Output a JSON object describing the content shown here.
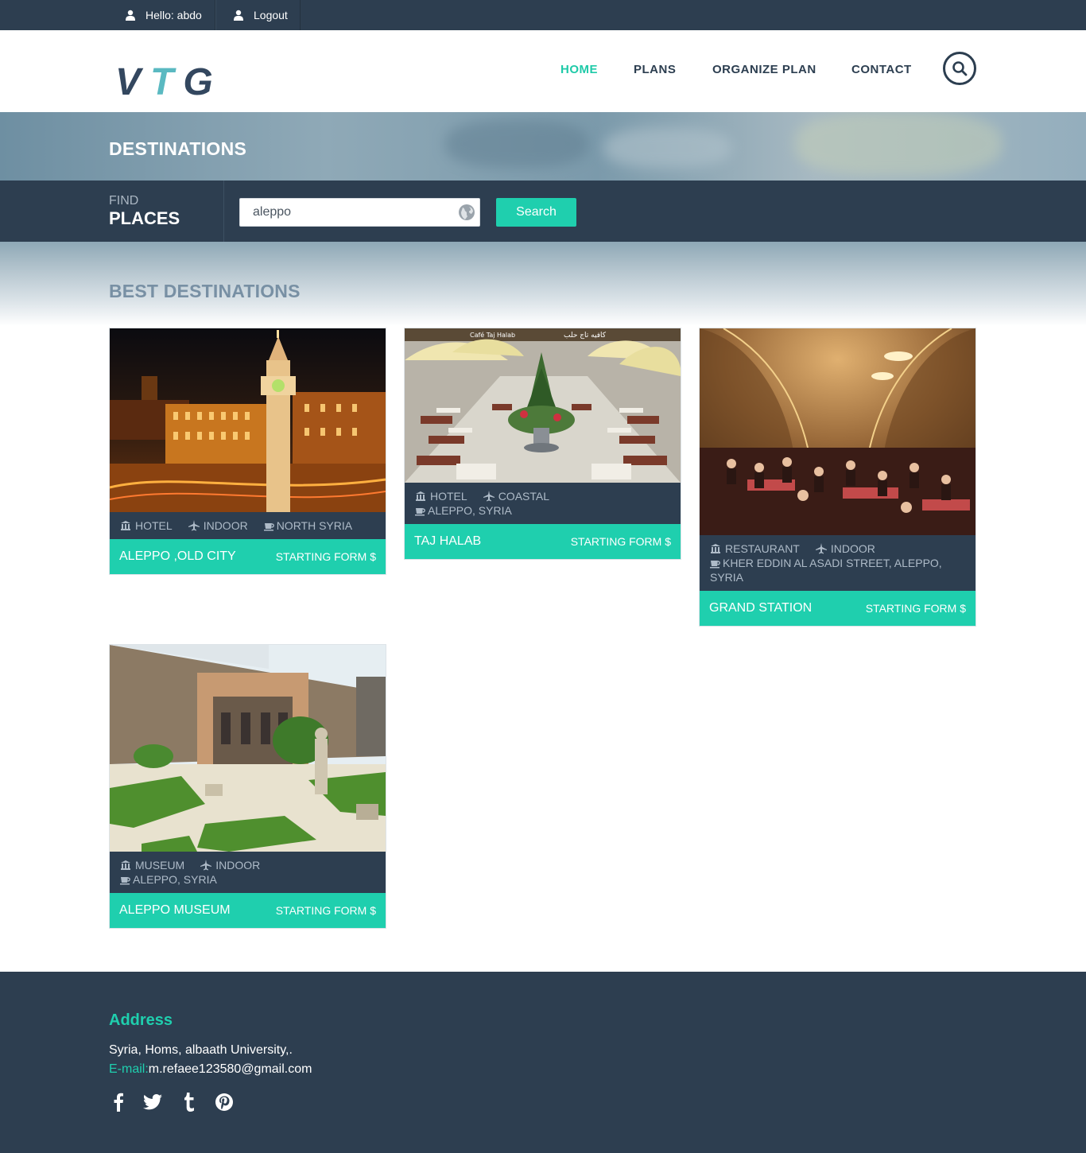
{
  "topbar": {
    "hello": "Hello: abdo",
    "logout": "Logout"
  },
  "brand": {
    "l1": "V",
    "l2": "T",
    "l3": "G"
  },
  "nav": {
    "home": "HOME",
    "plans": "PLANS",
    "organize": "ORGANIZE PLAN",
    "contact": "CONTACT"
  },
  "page": {
    "title": "DESTINATIONS"
  },
  "find": {
    "small": "FIND",
    "big": "PLACES",
    "query": "aleppo",
    "button": "Search"
  },
  "section": {
    "title": "BEST DESTINATIONS"
  },
  "cards": [
    {
      "type": "HOTEL",
      "category": "INDOOR",
      "location": "NORTH SYRIA",
      "name": "ALEPPO ,OLD CITY",
      "price": "STARTING FORM $",
      "image": "night city clock tower"
    },
    {
      "type": "HOTEL",
      "category": "COASTAL",
      "location": "ALEPPO, SYRIA",
      "name": "TAJ HALAB",
      "price": "STARTING FORM $",
      "image": "outdoor cafe courtyard",
      "sign_latin": "Café Taj Halab",
      "sign_arabic": "كافيه تاج حلب"
    },
    {
      "type": "RESTAURANT",
      "category": "INDOOR",
      "location": "KHER EDDIN AL ASADI STREET, ALEPPO, SYRIA",
      "name": "GRAND STATION",
      "price": "STARTING FORM $",
      "image": "vaulted restaurant hall"
    },
    {
      "type": "MUSEUM",
      "category": "INDOOR",
      "location": "ALEPPO, SYRIA",
      "name": "ALEPPO MUSEUM",
      "price": "STARTING FORM $",
      "image": "museum garden"
    }
  ],
  "footer": {
    "title": "Address",
    "address": "Syria, Homs, albaath University,.",
    "email_label": "E-mail:",
    "email": "m.refaee123580@gmail.com"
  },
  "social": [
    "facebook-icon",
    "twitter-icon",
    "tumblr-icon",
    "pinterest-icon"
  ],
  "colors": {
    "dark": "#2d3e50",
    "accent": "#1fcfae",
    "logo_accent": "#5ab9c1"
  }
}
